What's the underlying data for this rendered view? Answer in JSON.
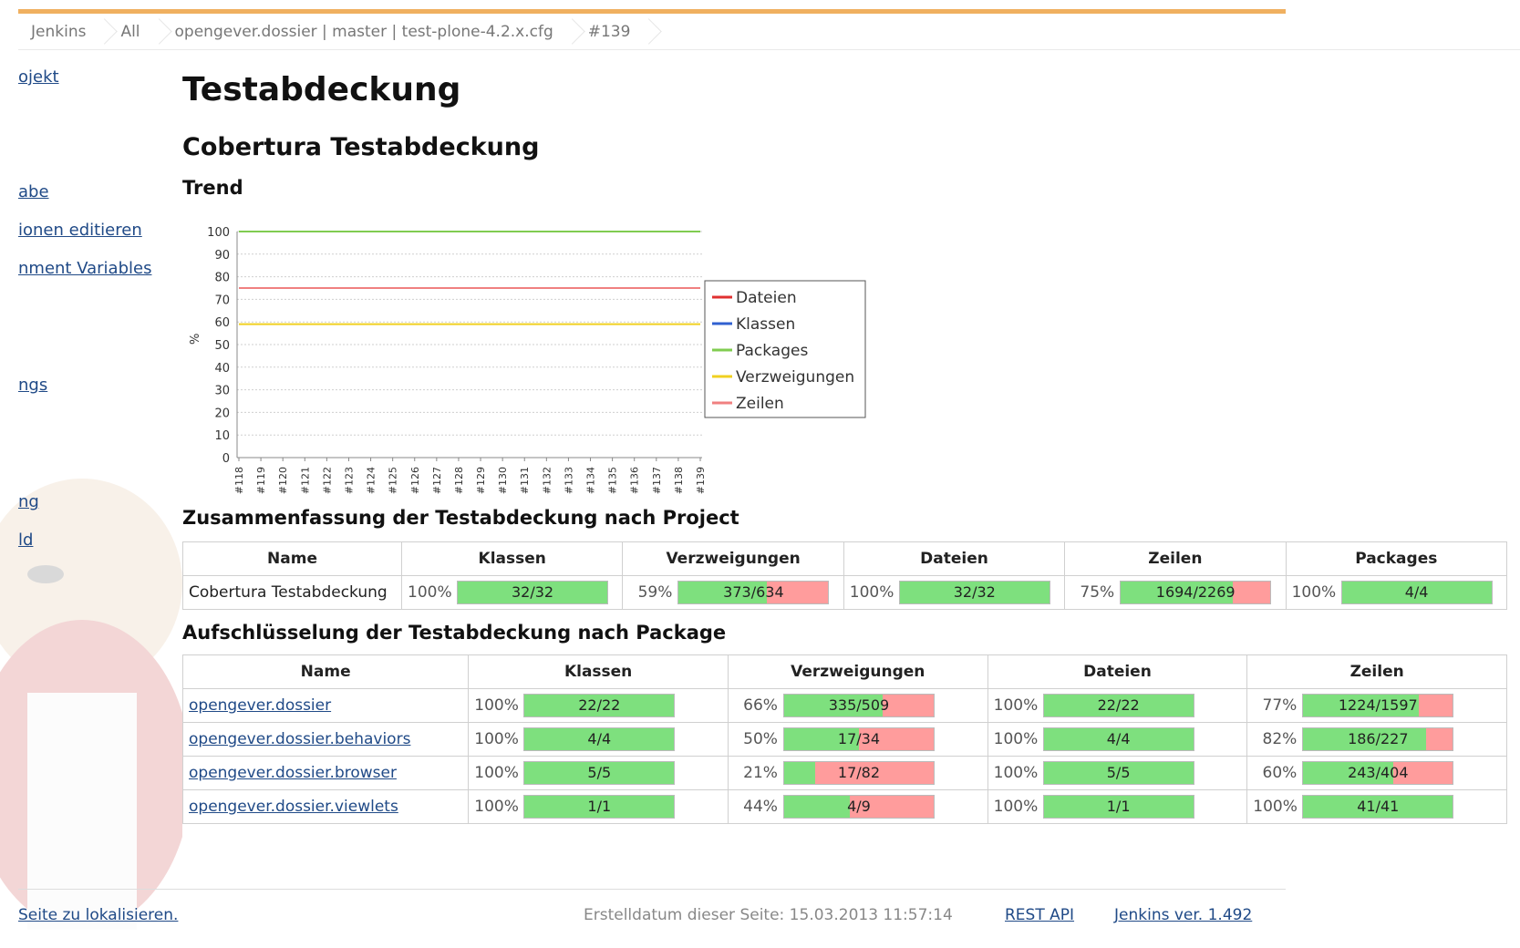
{
  "breadcrumb": [
    "Jenkins",
    "All",
    "opengever.dossier | master | test-plone-4.2.x.cfg",
    "#139"
  ],
  "sidebar": {
    "links": [
      "ojekt",
      "abe",
      "ionen editieren",
      "nment Variables",
      "ngs",
      "ng",
      "ld"
    ]
  },
  "page": {
    "title": "Testabdeckung",
    "subtitle": "Cobertura Testabdeckung",
    "trend_heading": "Trend",
    "summary_heading": "Zusammenfassung der Testabdeckung nach Project",
    "breakdown_heading": "Aufschlüsselung der Testabdeckung nach Package"
  },
  "chart_data": {
    "type": "line",
    "ylabel": "%",
    "ylim": [
      0,
      100
    ],
    "yticks": [
      "0",
      "10",
      "20",
      "30",
      "40",
      "50",
      "60",
      "70",
      "80",
      "90",
      "100"
    ],
    "x": [
      "#118",
      "#119",
      "#120",
      "#121",
      "#122",
      "#123",
      "#124",
      "#125",
      "#126",
      "#127",
      "#128",
      "#129",
      "#130",
      "#131",
      "#132",
      "#133",
      "#134",
      "#135",
      "#136",
      "#137",
      "#138",
      "#139"
    ],
    "series": [
      {
        "name": "Dateien",
        "color": "#e03030",
        "value": 100
      },
      {
        "name": "Klassen",
        "color": "#3060d0",
        "value": 100
      },
      {
        "name": "Packages",
        "color": "#80cc50",
        "value": 100
      },
      {
        "name": "Verzweigungen",
        "color": "#f0d020",
        "value": 59
      },
      {
        "name": "Zeilen",
        "color": "#f08080",
        "value": 75
      }
    ],
    "grid": true,
    "legend": "right"
  },
  "summary": {
    "headers": [
      "Name",
      "Klassen",
      "Verzweigungen",
      "Dateien",
      "Zeilen",
      "Packages"
    ],
    "row": {
      "name": "Cobertura Testabdeckung",
      "cells": [
        {
          "pct": "100%",
          "label": "32/32",
          "fill": 1.0
        },
        {
          "pct": "59%",
          "label": "373/634",
          "fill": 0.59
        },
        {
          "pct": "100%",
          "label": "32/32",
          "fill": 1.0
        },
        {
          "pct": "75%",
          "label": "1694/2269",
          "fill": 0.75
        },
        {
          "pct": "100%",
          "label": "4/4",
          "fill": 1.0
        }
      ]
    }
  },
  "breakdown": {
    "headers": [
      "Name",
      "Klassen",
      "Verzweigungen",
      "Dateien",
      "Zeilen"
    ],
    "rows": [
      {
        "name": "opengever.dossier",
        "cells": [
          {
            "pct": "100%",
            "label": "22/22",
            "fill": 1.0
          },
          {
            "pct": "66%",
            "label": "335/509",
            "fill": 0.66
          },
          {
            "pct": "100%",
            "label": "22/22",
            "fill": 1.0
          },
          {
            "pct": "77%",
            "label": "1224/1597",
            "fill": 0.77
          }
        ]
      },
      {
        "name": "opengever.dossier.behaviors",
        "cells": [
          {
            "pct": "100%",
            "label": "4/4",
            "fill": 1.0
          },
          {
            "pct": "50%",
            "label": "17/34",
            "fill": 0.5
          },
          {
            "pct": "100%",
            "label": "4/4",
            "fill": 1.0
          },
          {
            "pct": "82%",
            "label": "186/227",
            "fill": 0.82
          }
        ]
      },
      {
        "name": "opengever.dossier.browser",
        "cells": [
          {
            "pct": "100%",
            "label": "5/5",
            "fill": 1.0
          },
          {
            "pct": "21%",
            "label": "17/82",
            "fill": 0.21
          },
          {
            "pct": "100%",
            "label": "5/5",
            "fill": 1.0
          },
          {
            "pct": "60%",
            "label": "243/404",
            "fill": 0.6
          }
        ]
      },
      {
        "name": "opengever.dossier.viewlets",
        "cells": [
          {
            "pct": "100%",
            "label": "1/1",
            "fill": 1.0
          },
          {
            "pct": "44%",
            "label": "4/9",
            "fill": 0.44
          },
          {
            "pct": "100%",
            "label": "1/1",
            "fill": 1.0
          },
          {
            "pct": "100%",
            "label": "41/41",
            "fill": 1.0
          }
        ]
      }
    ]
  },
  "footer": {
    "localize": "Seite zu lokalisieren.",
    "created": "Erstelldatum dieser Seite: 15.03.2013 11:57:14",
    "rest_api": "REST API",
    "version": "Jenkins ver. 1.492"
  }
}
